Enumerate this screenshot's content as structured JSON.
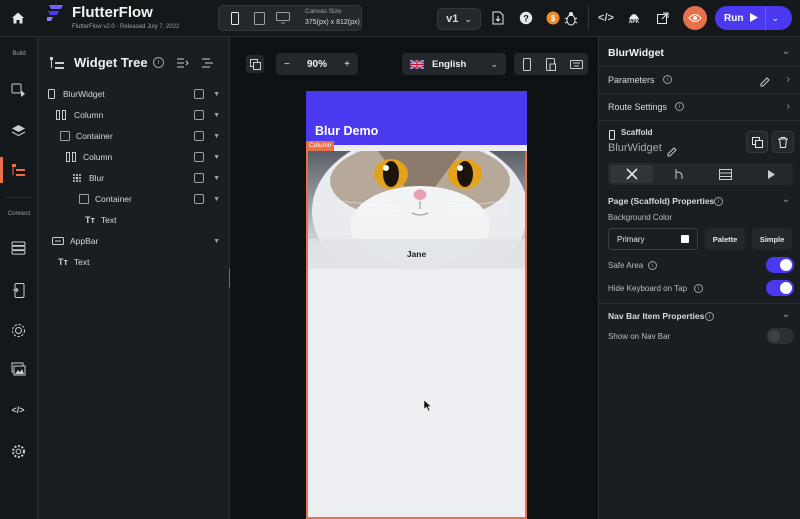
{
  "app": {
    "name": "FlutterFlow",
    "version": "FlutterFlow v2.0 - Released July 7, 2022"
  },
  "toolbar": {
    "canvas_size_label": "Canvas Size",
    "canvas_size_value": "375(px) x 812(px)",
    "version_label": "v1",
    "run_label": "Run",
    "apk_label": "APK"
  },
  "left_rail": {
    "build_label": "Build",
    "connect_label": "Connect"
  },
  "widget_tree": {
    "title": "Widget Tree",
    "items": [
      {
        "label": "BlurWidget"
      },
      {
        "label": "Column"
      },
      {
        "label": "Container"
      },
      {
        "label": "Column"
      },
      {
        "label": "Blur"
      },
      {
        "label": "Container"
      },
      {
        "label": "Text"
      },
      {
        "label": "AppBar"
      },
      {
        "label": "Text"
      }
    ]
  },
  "canvas": {
    "zoom": "90%",
    "language": "English",
    "appbar_title": "Blur Demo",
    "column_tag": "Column",
    "blur_text": "Jane"
  },
  "properties": {
    "widget_name": "BlurWidget",
    "parameters_label": "Parameters",
    "route_settings_label": "Route Settings",
    "scaffold_label": "Scaffold",
    "scaffold_name": "BlurWidget",
    "page_props_label": "Page (Scaffold) Properties",
    "bg_color_label": "Background Color",
    "primary_label": "Primary",
    "palette_label": "Palette",
    "simple_label": "Simple",
    "safe_area_label": "Safe Area",
    "hide_keyboard_label": "Hide Keyboard on Tap",
    "nav_bar_props_label": "Nav Bar Item Properties",
    "show_nav_bar_label": "Show on Nav Bar"
  },
  "colors": {
    "accent": "#4b39ef",
    "selection": "#e8704a",
    "panel": "#1a1e21"
  }
}
